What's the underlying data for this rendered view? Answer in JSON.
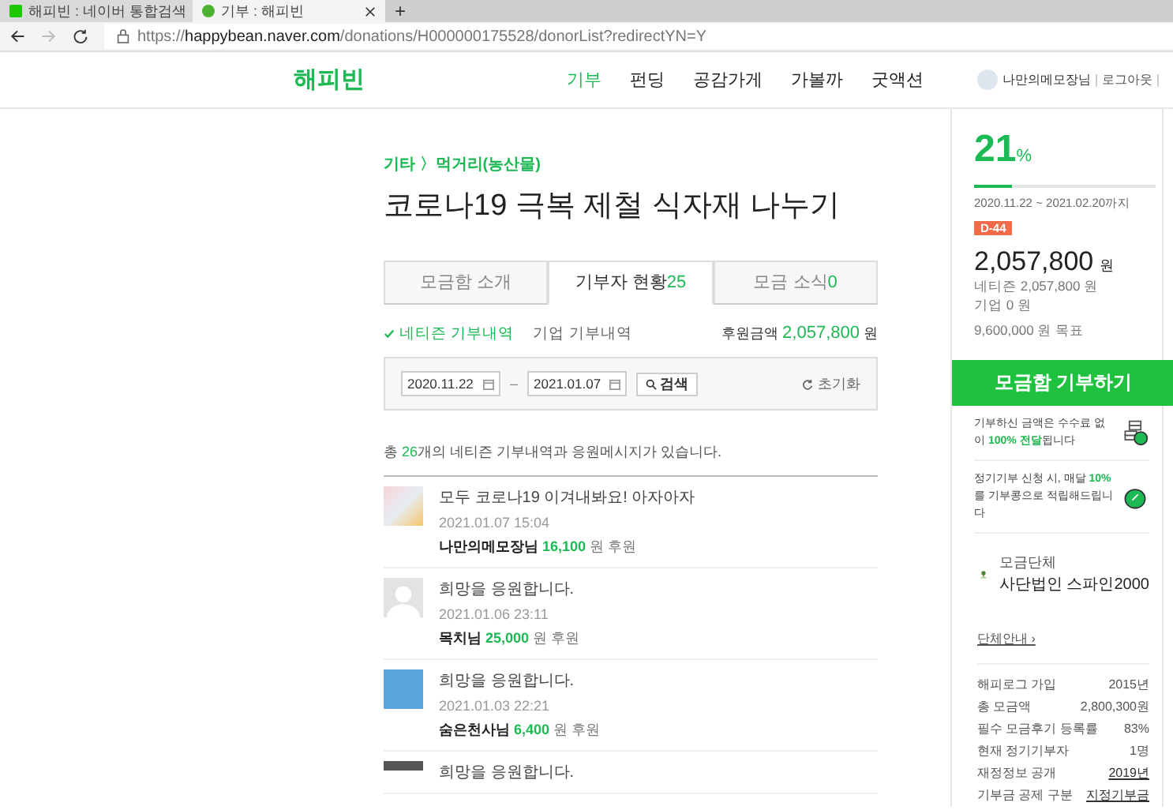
{
  "browser": {
    "tabs": [
      {
        "title": "해피빈 : 네이버 통합검색",
        "selected": false
      },
      {
        "title": "기부 : 해피빈",
        "selected": true
      }
    ],
    "new_tab": "+",
    "url_host": "happybean.naver.com",
    "url_prefix": "https://",
    "url_path": "/donations/H000000175528/donorList?redirectYN=Y"
  },
  "header": {
    "logo": "해피빈",
    "nav": [
      {
        "label": "기부",
        "selected": true
      },
      {
        "label": "펀딩",
        "selected": false
      },
      {
        "label": "공감가게",
        "selected": false
      },
      {
        "label": "가볼까",
        "selected": false
      },
      {
        "label": "굿액션",
        "selected": false
      }
    ],
    "user": "나만의메모장님",
    "logout": "로그아웃"
  },
  "campaign": {
    "category": "기타 〉먹거리(농산물)",
    "title": "코로나19 극복 제철 식자재 나누기"
  },
  "tabs": [
    {
      "label": "모금함 소개",
      "selected": false
    },
    {
      "label": "기부자 현황",
      "count": "25",
      "selected": true
    },
    {
      "label": "모금 소식",
      "count": "0",
      "selected": false
    }
  ],
  "filters": [
    {
      "label": "네티즌 기부내역",
      "selected": true
    },
    {
      "label": "기업 기부내역",
      "selected": false
    }
  ],
  "total": {
    "label": "후원금액",
    "amount": "2,057,800",
    "unit": "원"
  },
  "search": {
    "from": "2020.11.22",
    "sep": "–",
    "to": "2021.01.07",
    "button": "검색",
    "reset": "초기화"
  },
  "summary": "총 **26**개의 네티즌 기부내역과 응원메시지가 있습니다.",
  "donations": [
    {
      "message": "모두 코로나19 이겨내봐요! 아자아자",
      "date": "2021.01.07 15:04",
      "name": "나만의메모장님",
      "amount": "16,100",
      "suffix": "원 후원"
    },
    {
      "message": "희망을 응원합니다.",
      "date": "2021.01.06 23:11",
      "name": "목치님",
      "amount": "25,000",
      "suffix": "원 후원"
    },
    {
      "message": "희망을 응원합니다.",
      "date": "2021.01.03 22:21",
      "name": "숨은천사님",
      "amount": "6,400",
      "suffix": "원 후원"
    },
    {
      "message": "희망을 응원합니다."
    }
  ],
  "sidebar": {
    "percent": "21",
    "percent_unit": "%",
    "level": 0.21,
    "period": "2020.11.22 ~ 2021.02.20까지",
    "dday": "D-44",
    "amount": "2,057,800",
    "amount_unit": "원",
    "details": [
      "네티즌 2,057,800 원",
      "기업 0 원"
    ],
    "goal": "9,600,000 원 목표",
    "donate_button": "모금함 기부하기",
    "info": [
      {
        "text": "기부하신 금액은 수수료 없이 **100% 전달**됩니다"
      },
      {
        "text": "정기기부 신청 시, 매달 **10%**를 기부콩으로 적립해드립니다"
      }
    ],
    "org": {
      "label": "모금단체",
      "name": "사단법인 스파인2000",
      "link": "단체안내 ›"
    },
    "stats": [
      {
        "label": "해피로그 가입",
        "value": "2015년",
        "kind": "text"
      },
      {
        "label": "총 모금액",
        "value": "2,800,300원",
        "kind": "text"
      },
      {
        "label": "필수 모금후기 등록률",
        "value": "83%",
        "kind": "text"
      },
      {
        "label": "현재 정기기부자",
        "value": "1명",
        "kind": "text"
      },
      {
        "label": "재정정보 공개",
        "value": "2019년",
        "kind": "link"
      },
      {
        "label": "기부금 공제 구분",
        "value": "지정기부금",
        "kind": "link"
      }
    ]
  }
}
